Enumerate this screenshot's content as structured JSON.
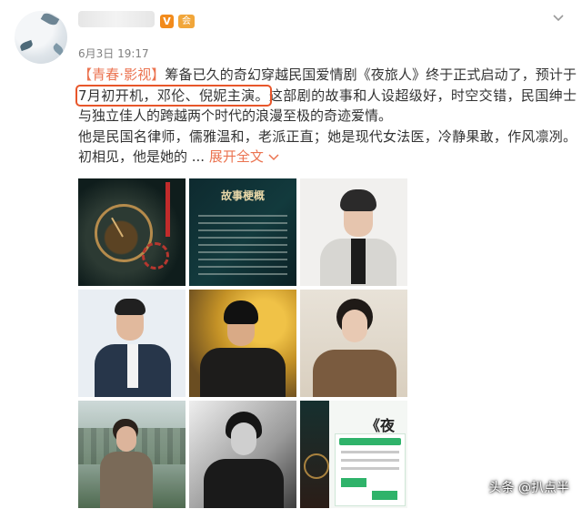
{
  "header": {
    "timestamp": "6月3日 19:17",
    "verified_badge": "V",
    "member_badge": "会"
  },
  "post": {
    "tag": "【青春·影视】",
    "text_1": "筹备已久的奇幻穿越民国爱情剧《夜旅人》终于正式启动了，预计于",
    "highlight": "7月初开机，邓伦、倪妮主演。",
    "text_2": "这部剧的故事和人设超级好，时空交错，民国绅士与独立佳人的跨越两个时代的浪漫至极的奇迹爱情。",
    "text_3": "他是民国名律师，儒雅温和，老派正直；她是现代女法医，冷静果敢，作风凛冽。初相见，他是她的 ...",
    "expand_label": "展开全文",
    "expand_icon": "chevron-down-icon"
  },
  "images": [
    {
      "alt": "poster-clock",
      "label": ""
    },
    {
      "alt": "story-outline",
      "label": "故事梗概"
    },
    {
      "alt": "actor-white-suit",
      "label": ""
    },
    {
      "alt": "actor-dark-suit",
      "label": ""
    },
    {
      "alt": "actor-gold-background",
      "label": ""
    },
    {
      "alt": "actress-plaid-jacket",
      "label": ""
    },
    {
      "alt": "actress-outdoor",
      "label": ""
    },
    {
      "alt": "actress-black-white",
      "label": ""
    },
    {
      "alt": "app-screenshot",
      "label": "《夜"
    }
  ],
  "watermark": "头条 @扒点半",
  "colors": {
    "accent": "#eb7350",
    "highlight_border": "#e8562a",
    "text": "#333333",
    "muted": "#808080"
  }
}
